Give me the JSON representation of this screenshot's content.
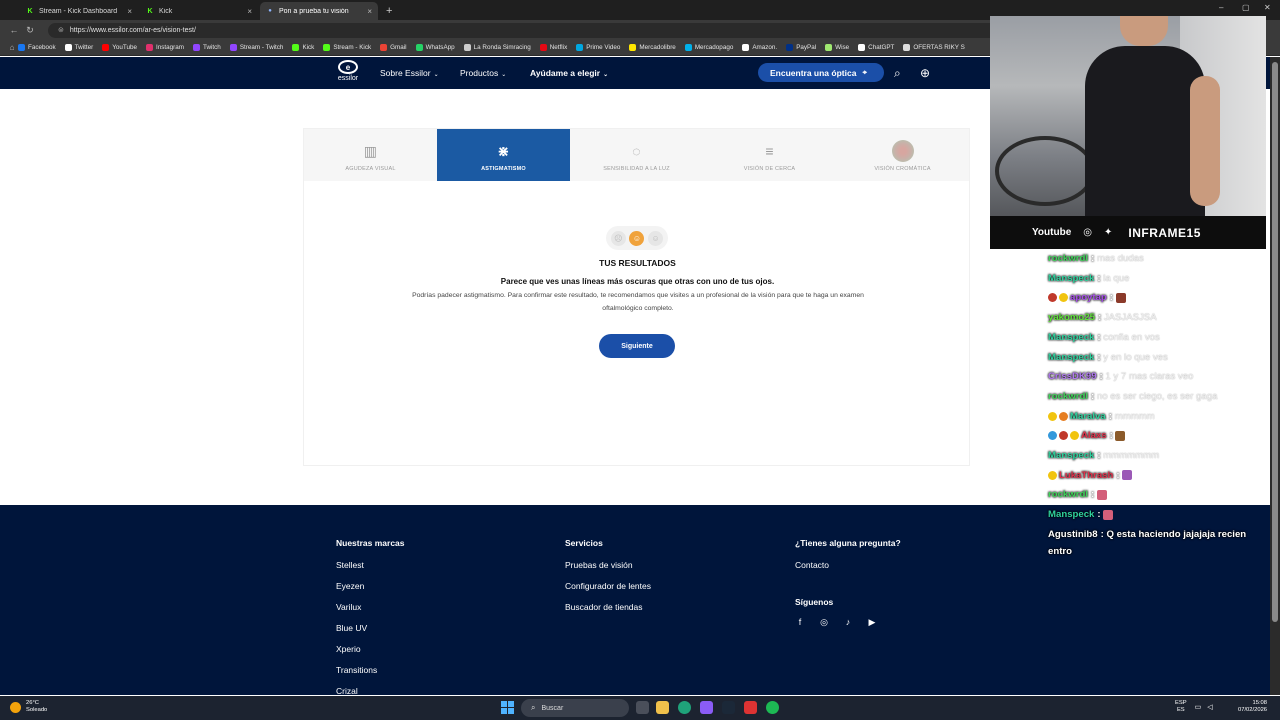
{
  "browser": {
    "tabs": [
      {
        "label": "Stream - Kick Dashboard",
        "favicon": "kick-icon",
        "active": false
      },
      {
        "label": "Kick",
        "favicon": "kick-icon",
        "active": false
      },
      {
        "label": "Pon a prueba tu visión",
        "favicon": "essilor-icon",
        "active": true
      }
    ],
    "url": "https://www.essilor.com/ar-es/vision-test/",
    "bookmarks": [
      {
        "label": "Facebook",
        "color": "#1877f2"
      },
      {
        "label": "Twitter",
        "color": "#ffffff"
      },
      {
        "label": "YouTube",
        "color": "#ff0000"
      },
      {
        "label": "Instagram",
        "color": "#e1306c"
      },
      {
        "label": "Twitch",
        "color": "#9146ff"
      },
      {
        "label": "Stream - Twitch",
        "color": "#9146ff"
      },
      {
        "label": "Kick",
        "color": "#53fc18"
      },
      {
        "label": "Stream - Kick",
        "color": "#53fc18"
      },
      {
        "label": "Gmail",
        "color": "#ea4335"
      },
      {
        "label": "WhatsApp",
        "color": "#25d366"
      },
      {
        "label": "La Ronda Simracing",
        "color": "#cccccc"
      },
      {
        "label": "Netflix",
        "color": "#e50914"
      },
      {
        "label": "Prime Video",
        "color": "#00a8e1"
      },
      {
        "label": "Mercadolibre",
        "color": "#ffe600"
      },
      {
        "label": "Mercadopago",
        "color": "#00b1ea"
      },
      {
        "label": "Amazon.",
        "color": "#ffffff"
      },
      {
        "label": "PayPal",
        "color": "#003087"
      },
      {
        "label": "Wise",
        "color": "#9fe870"
      },
      {
        "label": "ChatGPT",
        "color": "#ffffff"
      },
      {
        "label": "OFERTAS RIKY S",
        "color": "#dddddd"
      }
    ]
  },
  "site": {
    "logo_word": "essilor",
    "nav": [
      {
        "label": "Sobre Essilor",
        "bold": false
      },
      {
        "label": "Productos",
        "bold": false
      },
      {
        "label": "Ayúdame a elegir",
        "bold": true
      }
    ],
    "find_button": "Encuentra una óptica",
    "test_tabs": [
      {
        "label": "AGUDEZA VISUAL",
        "icon": "acuity-icon",
        "active": false
      },
      {
        "label": "ASTIGMATISMO",
        "icon": "astigmatism-icon",
        "active": true
      },
      {
        "label": "SENSIBILIDAD A LA LUZ",
        "icon": "light-sensitivity-icon",
        "active": false
      },
      {
        "label": "VISIÓN DE CERCA",
        "icon": "near-vision-icon",
        "active": false
      },
      {
        "label": "VISIÓN CROMÁTICA",
        "icon": "color-vision-icon",
        "active": false
      }
    ],
    "result": {
      "title": "TUS RESULTADOS",
      "subtitle": "Parece que ves unas líneas más oscuras que otras con uno de tus ojos.",
      "body": "Podrías padecer astigmatismo. Para confirmar este resultado, te recomendamos que visites a un profesional de la visión para que te haga un examen oftalmológico completo.",
      "next_button": "Siguiente",
      "selected_face": 1
    },
    "footer": {
      "brands": {
        "heading": "Nuestras marcas",
        "items": [
          "Stellest",
          "Eyezen",
          "Varilux",
          "Blue UV",
          "Xperio",
          "Transitions",
          "Crizal"
        ]
      },
      "services": {
        "heading": "Servicios",
        "items": [
          "Pruebas de visión",
          "Configurador de lentes",
          "Buscador de tiendas"
        ]
      },
      "questions": {
        "heading": "¿Tienes alguna pregunta?",
        "items": [
          "Contacto"
        ]
      },
      "follow": {
        "heading": "Síguenos",
        "icons": [
          "facebook-icon",
          "instagram-icon",
          "tiktok-icon",
          "youtube-icon"
        ]
      }
    }
  },
  "stream": {
    "social_label": "Youtube",
    "handle": "INFRAME15",
    "chat": [
      {
        "user": "rockwrdl",
        "color": "#3fd45a",
        "text": "mas dudas",
        "faint": true
      },
      {
        "user": "Manspeck",
        "color": "#2fd29e",
        "text": "la que",
        "faint": true
      },
      {
        "user": "apoytap",
        "color": "#a64ee8",
        "text": "",
        "faint": true,
        "badges": [
          "#c0392b",
          "#f1c40f"
        ],
        "emote": "#8b3a2a"
      },
      {
        "user": "yakomo25",
        "color": "#5fe23a",
        "text": "JASJASJSA",
        "faint": true
      },
      {
        "user": "Manspeck",
        "color": "#2fd29e",
        "text": "confia en vos",
        "faint": true
      },
      {
        "user": "Manspeck",
        "color": "#2fd29e",
        "text": "y en lo que ves",
        "faint": true
      },
      {
        "user": "CrissDK99",
        "color": "#b077f0",
        "text": "1 y 7 mas claras veo",
        "faint": true
      },
      {
        "user": "rockwrdl",
        "color": "#3fd45a",
        "text": "no es ser ciego, es ser gaga",
        "faint": true
      },
      {
        "user": "Maralva",
        "color": "#2fd29e",
        "text": "mmmmm",
        "faint": true,
        "badges": [
          "#f1c40f",
          "#e67e22"
        ]
      },
      {
        "user": "Alaxs",
        "color": "#e0304a",
        "text": "",
        "faint": true,
        "badges": [
          "#3498db",
          "#c0392b",
          "#f1c40f"
        ],
        "emote": "#8b5a2a"
      },
      {
        "user": "Manspeck",
        "color": "#2fd29e",
        "text": "mmmmmmm",
        "faint": true
      },
      {
        "user": "LukaThrash",
        "color": "#e0304a",
        "text": "",
        "faint": false,
        "badges": [
          "#f1c40f"
        ],
        "emote": "#9b59b6"
      },
      {
        "user": "rockwrdl",
        "color": "#3fd45a",
        "text": "",
        "faint": true,
        "emote": "#d35f7a"
      },
      {
        "user": "Manspeck",
        "color": "#2fd29e",
        "text": "",
        "faint": false,
        "emote": "#d35f7a"
      },
      {
        "user": "Agustinib8",
        "color": "#ffffff",
        "text": "Q esta haciendo jajajaja recien entro",
        "faint": false,
        "wrap": true
      }
    ]
  },
  "taskbar": {
    "weather_temp": "26°C",
    "weather_desc": "Soleado",
    "search_placeholder": "Buscar",
    "lang_top": "ESP",
    "lang_bottom": "ES",
    "time": "15:08",
    "date": "07/02/2026"
  }
}
